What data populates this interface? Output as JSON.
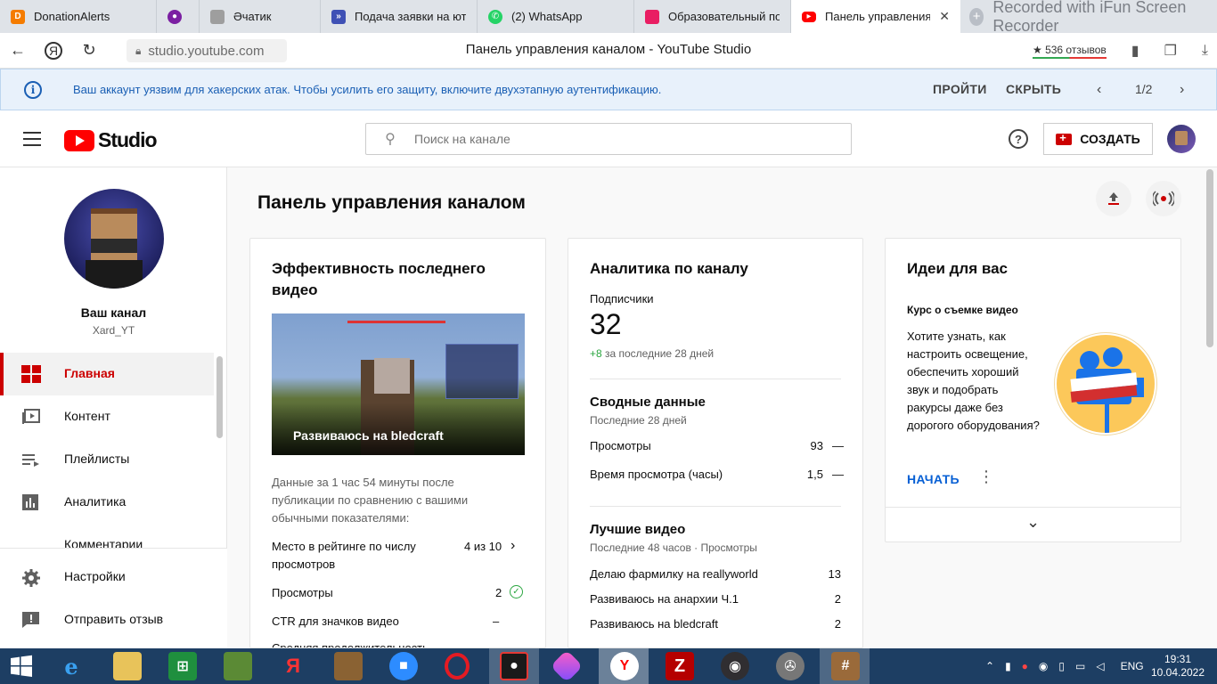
{
  "browser": {
    "tabs": [
      {
        "label": "DonationAlerts",
        "icon": "donationalerts-icon",
        "color": "#f57c00"
      },
      {
        "label": "",
        "icon": "record-icon",
        "color": "#7b1fa2"
      },
      {
        "label": "Әчатик",
        "icon": "page-icon",
        "color": "#9e9e9e"
      },
      {
        "label": "Подача заявки на юту",
        "icon": "form-icon",
        "color": "#3f51b5"
      },
      {
        "label": "(2) WhatsApp",
        "icon": "whatsapp-icon",
        "color": "#25d366"
      },
      {
        "label": "Образовательный пор",
        "icon": "edu-icon",
        "color": "#e91e63"
      },
      {
        "label": "Панель управления",
        "icon": "youtube-icon",
        "color": "#ff0000"
      }
    ],
    "recorder_text": "Recorded with iFun Screen Recorder",
    "url": "studio.youtube.com",
    "page_title": "Панель управления каналом - YouTube Studio",
    "reviews": "★ 536 отзывов"
  },
  "banner": {
    "message": "Ваш аккаунт уязвим для хакерских атак. Чтобы усилить его защиту, включите двухэтапную аутентификацию.",
    "go_label": "ПРОЙТИ",
    "hide_label": "СКРЫТЬ",
    "pager": "1/2"
  },
  "header": {
    "logo_text": "Studio",
    "search_placeholder": "Поиск на канале",
    "create_label": "СОЗДАТЬ"
  },
  "sidebar": {
    "channel_label": "Ваш канал",
    "channel_handle": "Xard_YT",
    "items": [
      {
        "label": "Главная",
        "icon": "dashboard-icon"
      },
      {
        "label": "Контент",
        "icon": "content-icon"
      },
      {
        "label": "Плейлисты",
        "icon": "playlists-icon"
      },
      {
        "label": "Аналитика",
        "icon": "analytics-icon"
      },
      {
        "label": "Комментарии",
        "icon": "comments-icon"
      }
    ],
    "bottom": [
      {
        "label": "Настройки",
        "icon": "settings-icon"
      },
      {
        "label": "Отправить отзыв",
        "icon": "feedback-icon"
      }
    ]
  },
  "main": {
    "title": "Панель управления каналом",
    "latest": {
      "title": "Эффективность последнего видео",
      "thumb_title": "Развиваюсь на bledcraft",
      "description": "Данные за 1 час 54 минуты после публикации по сравнению с вашими обычными показателями:",
      "rank_label": "Место в рейтинге по числу просмотров",
      "rank_value": "4 из 10",
      "views_label": "Просмотры",
      "views_value": "2",
      "ctr_label": "CTR для значков видео",
      "ctr_value": "–",
      "cut_label": "Средняя продолжительность"
    },
    "analytics": {
      "title": "Аналитика по каналу",
      "subs_label": "Подписчики",
      "subs_value": "32",
      "subs_delta": "+8",
      "subs_period": "за последние 28 дней",
      "summary_title": "Сводные данные",
      "summary_period": "Последние 28 дней",
      "rows": [
        {
          "label": "Просмотры",
          "value": "93",
          "trend": "—"
        },
        {
          "label": "Время просмотра (часы)",
          "value": "1,5",
          "trend": "—"
        }
      ],
      "top_title": "Лучшие видео",
      "top_period": "Последние 48 часов · Просмотры",
      "top_videos": [
        {
          "label": "Делаю фармилку на reallyworld",
          "value": "13"
        },
        {
          "label": "Развиваюсь на анархии Ч.1",
          "value": "2"
        },
        {
          "label": "Развиваюсь на bledcraft",
          "value": "2"
        }
      ]
    },
    "ideas": {
      "title": "Идеи для вас",
      "course_title": "Курс о съемке видео",
      "course_text": "Хотите узнать, как настроить освещение, обеспечить хороший звук и подобрать ракурсы даже без дорогого оборудования?",
      "start_label": "НАЧАТЬ"
    }
  },
  "taskbar": {
    "lang": "ENG",
    "time": "19:31",
    "date": "10.04.2022"
  }
}
